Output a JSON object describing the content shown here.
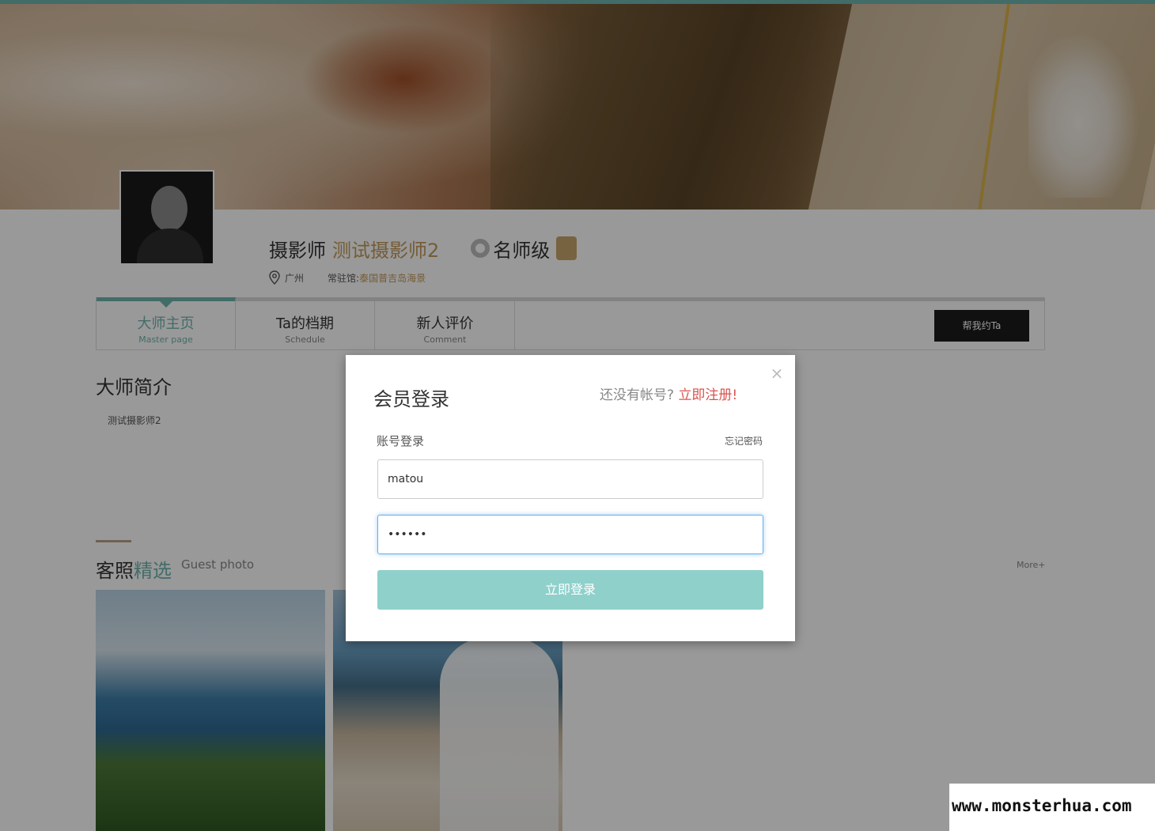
{
  "banner": {
    "description_icon": "landscape-banner"
  },
  "profile": {
    "role_prefix": "摄影师",
    "name": "测试摄影师2",
    "rank": "名师级",
    "location": "广州",
    "studio_label": "常驻馆:",
    "studio_value": "泰国普吉岛海景"
  },
  "tabs": [
    {
      "label": "大师主页",
      "sub": "Master page",
      "active": true
    },
    {
      "label": "Ta的档期",
      "sub": "Schedule",
      "active": false
    },
    {
      "label": "新人评价",
      "sub": "Comment",
      "active": false
    }
  ],
  "book_button": "帮我约Ta",
  "intro": {
    "title": "大师简介",
    "text": "测试摄影师2"
  },
  "guest_photos": {
    "title_plain": "客照",
    "title_highlight": "精选",
    "subtitle": "Guest photo",
    "more": "More+"
  },
  "modal": {
    "close": "×",
    "title": "会员登录",
    "register_prompt": "还没有帐号?",
    "register_link": "立即注册!",
    "account_label": "账号登录",
    "forgot": "忘记密码",
    "username": "matou",
    "password": "••••••",
    "login_button": "立即登录"
  },
  "colors": {
    "accent": "#6fb4ad",
    "gold": "#c19a5b",
    "register_red": "#d9534f",
    "login_button": "#8fd0cb"
  },
  "watermark": "www.monsterhua.com"
}
